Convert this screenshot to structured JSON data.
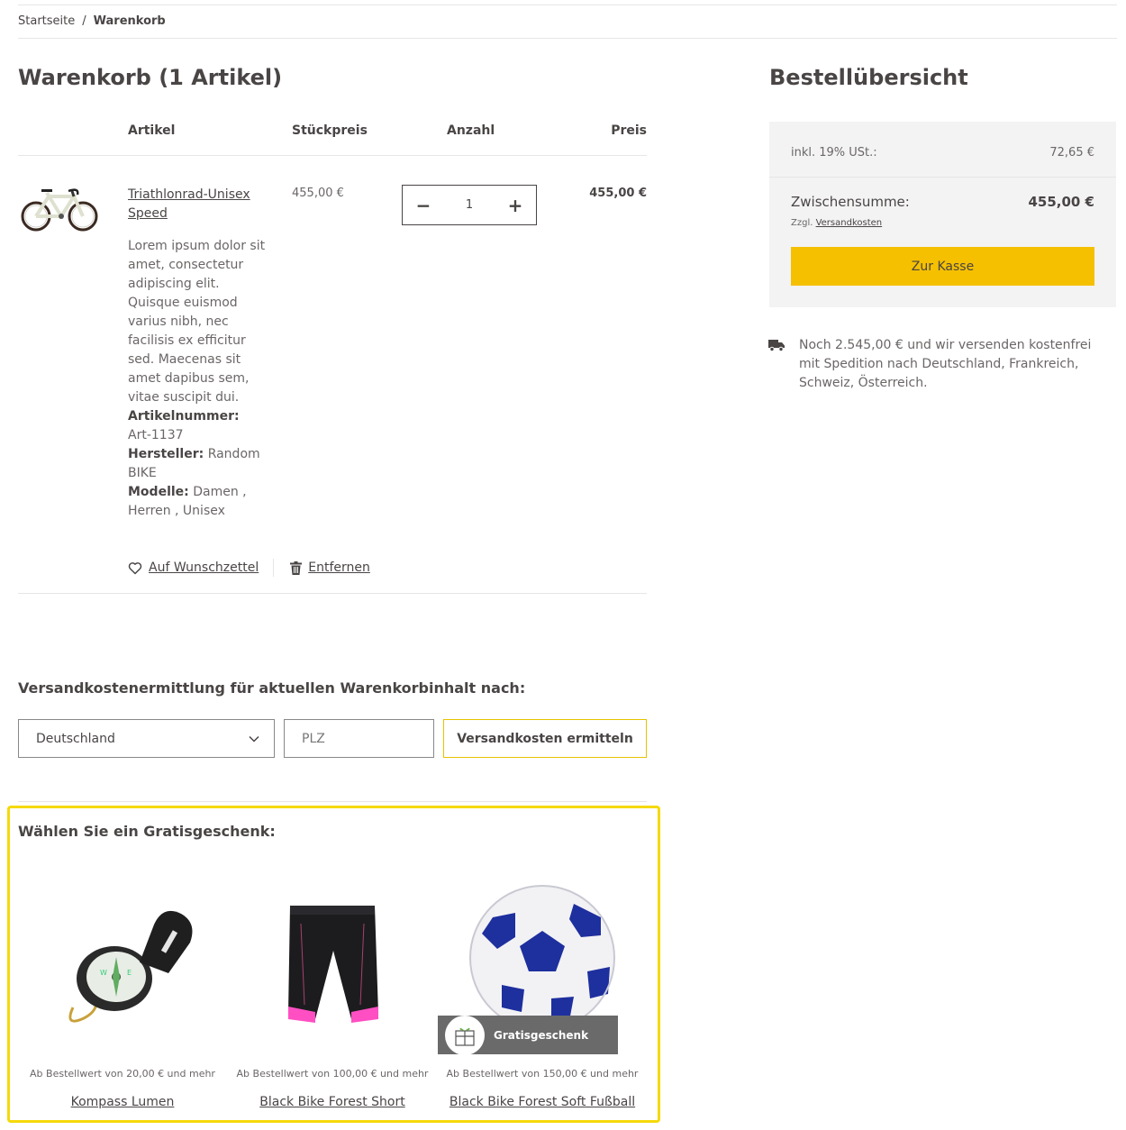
{
  "breadcrumb": {
    "home": "Startseite",
    "separator": "/",
    "current": "Warenkorb"
  },
  "cart": {
    "title": "Warenkorb (1 Artikel)",
    "columns": {
      "article": "Artikel",
      "unit_price": "Stückpreis",
      "quantity": "Anzahl",
      "price": "Preis"
    },
    "item": {
      "name": "Triathlonrad-Unisex Speed",
      "description": "Lorem ipsum dolor sit amet, consectetur adipiscing elit. Quisque euismod varius nibh, nec facilisis ex efficitur sed. Maecenas sit amet dapibus sem, vitae suscipit dui.",
      "article_number_label": "Artikelnummer:",
      "article_number": "Art-1137",
      "manufacturer_label": "Hersteller:",
      "manufacturer": "Random BIKE",
      "models_label": "Modelle:",
      "models": "Damen , Herren , Unisex",
      "unit_price": "455,00 €",
      "quantity": "1",
      "price": "455,00 €",
      "image_icon": "bicycle-image"
    },
    "actions": {
      "wishlist": "Auf Wunschzettel",
      "remove": "Entfernen"
    }
  },
  "shipping_calc": {
    "title": "Versandkostenermittlung für aktuellen Warenkorbinhalt nach:",
    "country": "Deutschland",
    "plz_placeholder": "PLZ",
    "button": "Versandkosten ermitteln"
  },
  "gifts": {
    "title": "Wählen Sie ein Gratisgeschenk:",
    "items": [
      {
        "name": "Kompass Lumen",
        "condition": "Ab Bestellwert von 20,00 € und mehr",
        "icon": "compass-image"
      },
      {
        "name": "Black Bike Forest Short",
        "condition": "Ab Bestellwert von 100,00 € und mehr",
        "icon": "cycling-shorts-image"
      },
      {
        "name": "Black Bike Forest Soft Fußball",
        "condition": "Ab Bestellwert von 150,00 € und mehr",
        "icon": "football-image",
        "badge": "Gratisgeschenk"
      }
    ]
  },
  "summary": {
    "title": "Bestellübersicht",
    "vat_label": "inkl. 19% USt.:",
    "vat_value": "72,65 €",
    "subtotal_label": "Zwischensumme:",
    "subtotal_value": "455,00 €",
    "shipping_note_prefix": "Zzgl.",
    "shipping_note_link": "Versandkosten",
    "checkout_button": "Zur Kasse",
    "free_shipping_text": "Noch 2.545,00 € und wir versenden kostenfrei mit Spedition nach Deutschland, Frankreich, Schweiz, Österreich."
  },
  "colors": {
    "accent": "#f5c000",
    "highlight_border": "#f5d90a",
    "text": "#4a4545",
    "summary_bg": "#f3f3f4"
  }
}
